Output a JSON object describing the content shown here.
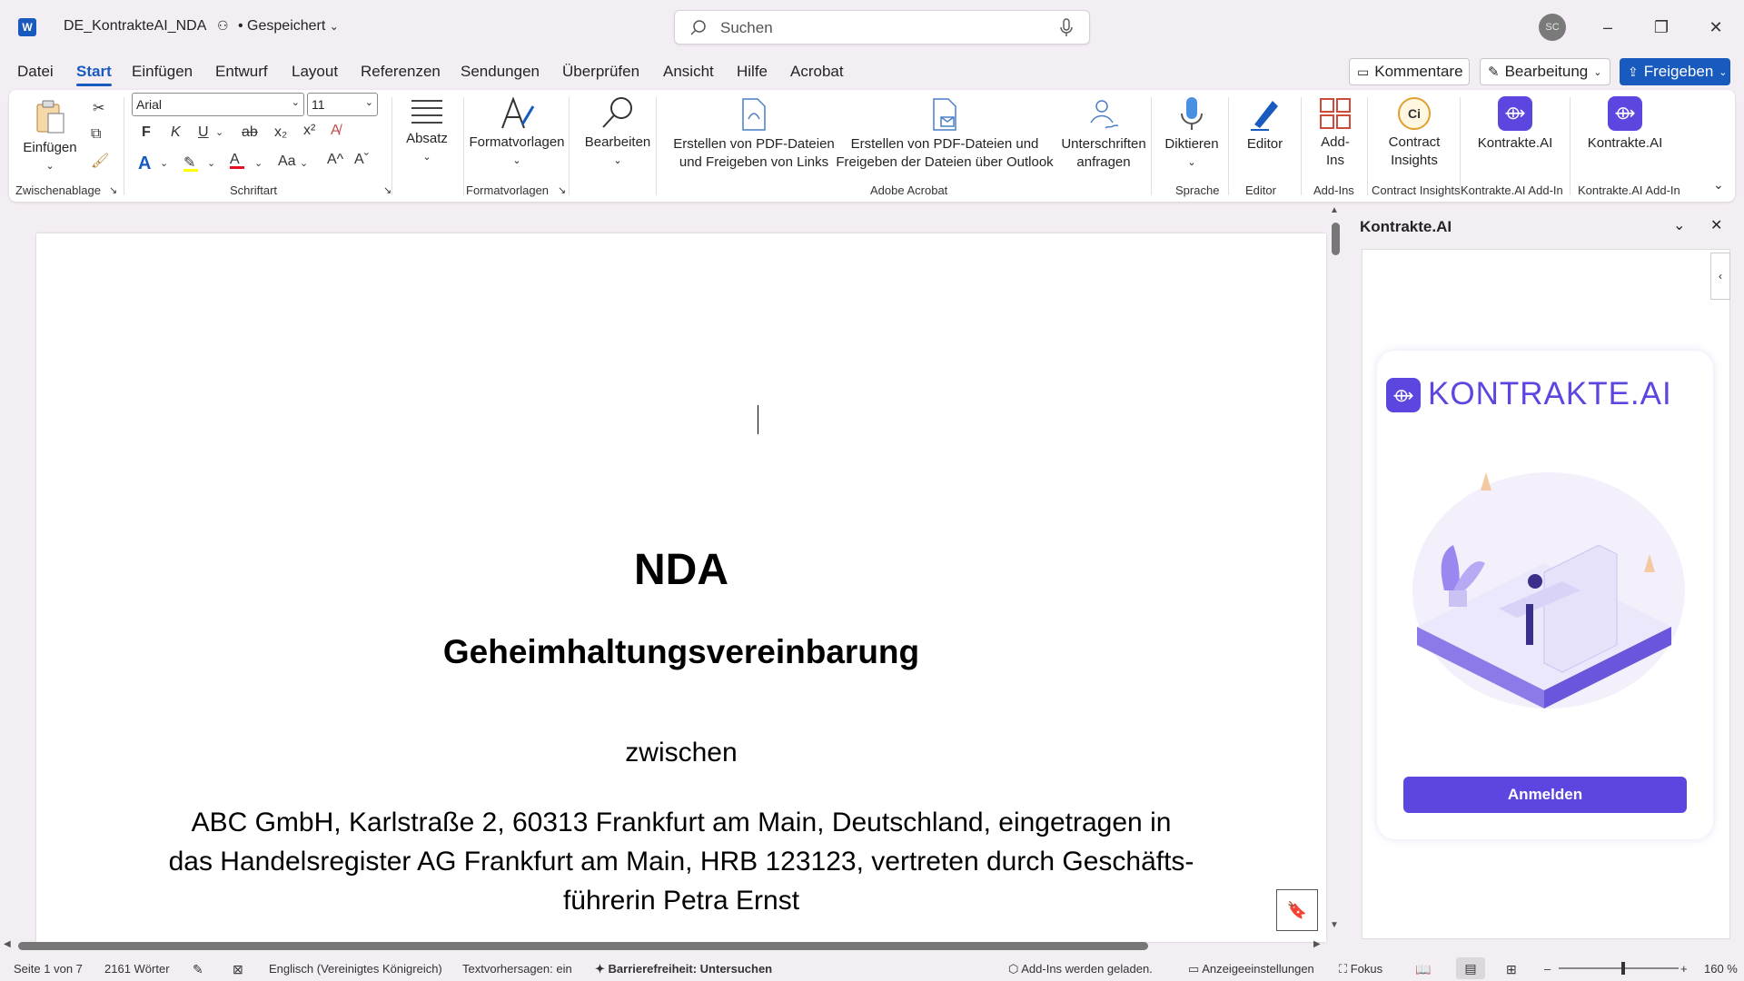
{
  "app": {
    "logo_letter": "W",
    "doc_title": "DE_KontrakteAI_NDA",
    "save_state": "• Gespeichert",
    "user_initials": "SC"
  },
  "search": {
    "placeholder": "Suchen"
  },
  "menu": {
    "items": [
      "Datei",
      "Start",
      "Einfügen",
      "Entwurf",
      "Layout",
      "Referenzen",
      "Sendungen",
      "Überprüfen",
      "Ansicht",
      "Hilfe",
      "Acrobat"
    ],
    "active": "Start"
  },
  "top_buttons": {
    "comments": "Kommentare",
    "editing": "Bearbeitung",
    "share": "Freigeben"
  },
  "ribbon": {
    "clipboard": {
      "paste": "Einfügen",
      "label": "Zwischenablage"
    },
    "font": {
      "family": "Arial",
      "size": "11",
      "bold": "F",
      "italic": "K",
      "underline": "U",
      "strike": "ab",
      "sub": "x₂",
      "sup": "x²",
      "case": "Aa",
      "grow": "A^",
      "shrink": "Aˇ",
      "label": "Schriftart"
    },
    "paragraph": {
      "label": "Absatz"
    },
    "styles": {
      "button": "Formatvorlagen",
      "label": "Formatvorlagen"
    },
    "editing": {
      "label": "Bearbeiten"
    },
    "acrobat": {
      "pdf_links": "Erstellen von PDF-Dateien und Freigeben von Links",
      "pdf_outlook": "Erstellen von PDF-Dateien und Freigeben der Dateien über Outlook",
      "signatures": "Unterschriften anfragen",
      "label": "Adobe Acrobat"
    },
    "voice": {
      "dictate": "Diktieren",
      "label": "Sprache"
    },
    "editor": {
      "button": "Editor",
      "label": "Editor"
    },
    "addins": {
      "button": "Add-Ins",
      "label": "Add-Ins"
    },
    "contract": {
      "icon_text": "Ci",
      "button": "Contract Insights",
      "label": "Contract Insights"
    },
    "kontrakte1": {
      "button": "Kontrakte.AI",
      "label": "Kontrakte.AI Add-In"
    },
    "kontrakte2": {
      "button": "Kontrakte.AI",
      "label": "Kontrakte.AI Add-In"
    }
  },
  "document": {
    "title": "NDA",
    "subtitle": "Geheimhaltungsvereinbarung",
    "between": "zwischen",
    "party1_line1": "ABC GmbH, Karlstraße 2, 60313 Frankfurt am Main, Deutschland, eingetragen in",
    "party1_line2": "das Handelsregister AG Frankfurt am Main, HRB 123123, vertreten durch Geschäfts-",
    "party1_line3": "führerin Petra Ernst"
  },
  "pane": {
    "title": "Kontrakte.AI",
    "brand": "KONTRAKTE.AI",
    "signin": "Anmelden"
  },
  "status": {
    "page": "Seite 1 von 7",
    "words": "2161 Wörter",
    "language": "Englisch (Vereinigtes Königreich)",
    "predictions": "Textvorhersagen: ein",
    "accessibility": "Barrierefreiheit: Untersuchen",
    "addins_loading": "Add-Ins werden geladen.",
    "display": "Anzeigeeinstellungen",
    "focus": "Fokus",
    "zoom": "160 %"
  },
  "colors": {
    "accent": "#185abd",
    "brand": "#5b47e0"
  }
}
